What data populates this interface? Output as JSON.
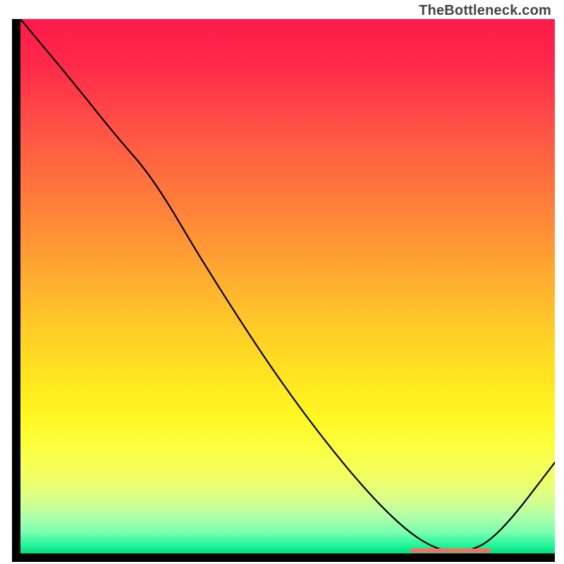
{
  "watermark": "TheBottleneck.com",
  "chart_data": {
    "type": "line",
    "title": "",
    "xlabel": "",
    "ylabel": "",
    "xlim": [
      0,
      100
    ],
    "ylim": [
      0,
      100
    ],
    "grid": false,
    "background_gradient": {
      "orientation": "vertical",
      "stops": [
        {
          "pos": 0.0,
          "color": "#ff1a4b"
        },
        {
          "pos": 0.5,
          "color": "#ffcc28"
        },
        {
          "pos": 0.8,
          "color": "#fcff3e"
        },
        {
          "pos": 1.0,
          "color": "#00e07a"
        }
      ]
    },
    "series": [
      {
        "name": "bottleneck-curve",
        "color": "#000000",
        "x": [
          0,
          10,
          18,
          25,
          35,
          50,
          65,
          76,
          84,
          90,
          100
        ],
        "values": [
          100,
          88,
          78,
          70,
          53,
          30,
          11,
          1,
          0,
          4,
          17
        ]
      }
    ],
    "annotations": [
      {
        "name": "optimal-range",
        "type": "band-x",
        "x_start": 73,
        "x_end": 88,
        "y": 0,
        "color": "#ff6a64"
      }
    ]
  }
}
